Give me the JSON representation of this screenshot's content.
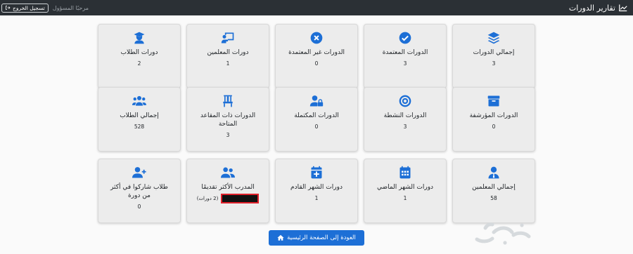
{
  "topbar": {
    "brand": "تقارير الدورات",
    "welcome": "مرحبًا المسؤول",
    "logout_label": "تسجيل الخروج"
  },
  "cards": [
    {
      "label": "إجمالي الدورات",
      "value": "3",
      "icon": "layers-icon"
    },
    {
      "label": "الدورات المعتمدة",
      "value": "3",
      "icon": "check-circle-icon"
    },
    {
      "label": "الدورات غير المعتمدة",
      "value": "0",
      "icon": "x-circle-icon"
    },
    {
      "label": "دورات المعلمين",
      "value": "1",
      "icon": "chalkboard-teacher-icon"
    },
    {
      "label": "دورات الطلاب",
      "value": "2",
      "icon": "graduate-icon"
    },
    {
      "label": "الدورات المؤرشفة",
      "value": "0",
      "icon": "archive-icon"
    },
    {
      "label": "الدورات النشطة",
      "value": "3",
      "icon": "target-icon"
    },
    {
      "label": "الدورات المكتملة",
      "value": "0",
      "icon": "user-lock-icon"
    },
    {
      "label": "الدورات ذات المقاعد المتاحة",
      "value": "3",
      "icon": "chair-icon"
    },
    {
      "label": "إجمالي الطلاب",
      "value": "528",
      "icon": "users-icon"
    },
    {
      "label": "إجمالي المعلمين",
      "value": "58",
      "icon": "user-tie-icon"
    },
    {
      "label": "دورات الشهر الماضي",
      "value": "1",
      "icon": "calendar-icon"
    },
    {
      "label": "دورات الشهر القادم",
      "value": "1",
      "icon": "calendar-plus-icon"
    },
    {
      "label": "المدرب الأكثر تقديمًا",
      "value": "(2 دورات)",
      "icon": "user-group-icon"
    },
    {
      "label": "طلاب شاركوا في أكثر من دورة",
      "value": "0",
      "icon": "user-plus-icon"
    }
  ],
  "home_button": "العودة إلى الصفحة الرئيسية",
  "colors": {
    "accent": "#1d6fd6",
    "topbar": "#2b3035",
    "card": "#ececec"
  }
}
